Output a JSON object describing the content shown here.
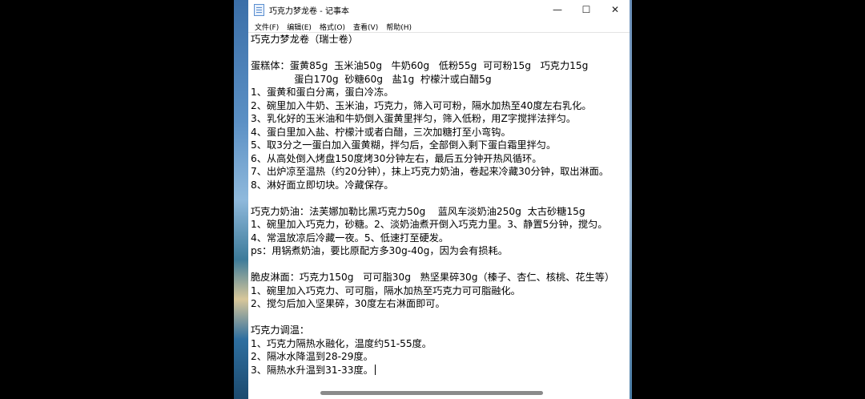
{
  "window": {
    "title": "巧克力梦龙卷 - 记事本",
    "controls": {
      "minimize": "—",
      "maximize": "☐",
      "close": "✕"
    }
  },
  "menu": [
    "文件(F)",
    "编辑(E)",
    "格式(O)",
    "查看(V)",
    "帮助(H)"
  ],
  "document": {
    "lines": [
      "巧克力梦龙卷（瑞士卷）",
      "",
      "蛋糕体：蛋黄85g  玉米油50g   牛奶60g   低粉55g  可可粉15g   巧克力15g",
      "              蛋白170g  砂糖60g   盐1g  柠檬汁或白醋5g",
      "1、蛋黄和蛋白分离，蛋白冷冻。",
      "2、碗里加入牛奶、玉米油，巧克力，筛入可可粉，隔水加热至40度左右乳化。",
      "3、乳化好的玉米油和牛奶倒入蛋黄里拌匀，筛入低粉，用Z字搅拌法拌匀。",
      "4、蛋白里加入盐、柠檬汁或者白醋，三次加糖打至小弯钩。",
      "5、取3分之一蛋白加入蛋黄糊，拌匀后，全部倒入剩下蛋白霜里拌匀。",
      "6、从高处倒入烤盘150度烤30分钟左右，最后五分钟开热风循环。",
      "7、出炉凉至温热（约20分钟），抹上巧克力奶油，卷起来冷藏30分钟，取出淋面。",
      "8、淋好面立即切块。冷藏保存。",
      "",
      "巧克力奶油：法芙娜加勒比黑巧克力50g    蓝风车淡奶油250g  太古砂糖15g",
      "1、碗里加入巧克力，砂糖。2、淡奶油煮开倒入巧克力里。3、静置5分钟，搅匀。",
      "4、常温放凉后冷藏一夜。5、低速打至硬发。",
      "ps：用锅煮奶油，要比原配方多30g-40g，因为会有损耗。",
      "",
      "脆皮淋面：巧克力150g   可可脂30g   熟坚果碎30g（榛子、杏仁、核桃、花生等）",
      "1、碗里加入巧克力、可可脂，隔水加热至巧克力可可脂融化。",
      "2、搅匀后加入坚果碎，30度左右淋面即可。",
      "",
      "巧克力调温：",
      "1、巧克力隔热水融化，温度约51-55度。",
      "2、隔冰水降温到28-29度。",
      "3、隔热水升温到31-33度。"
    ]
  }
}
